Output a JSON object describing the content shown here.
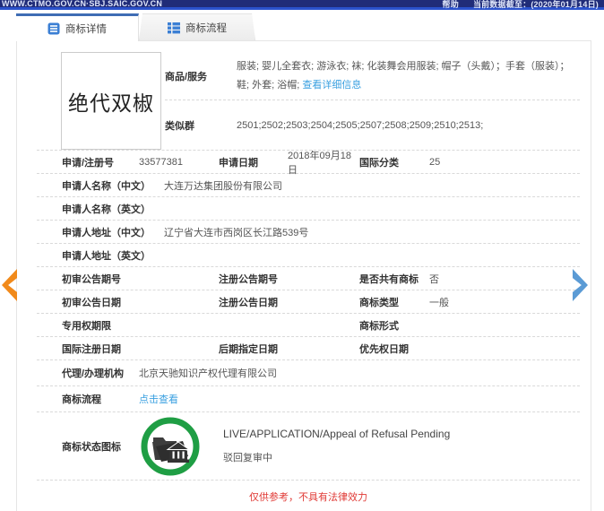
{
  "topbar": {
    "site": "WWW.CTMO.GOV.CN·SBJ.SAIC.GOV.CN",
    "help": "帮助",
    "data_cutoff": "当前数据截至：(2020年01月14日)"
  },
  "tabs": [
    {
      "label": "商标详情"
    },
    {
      "label": "商标流程"
    }
  ],
  "trademark": {
    "name": "绝代双椒",
    "goods_label": "商品/服务",
    "goods": "服装; 婴儿全套衣; 游泳衣; 袜; 化装舞会用服装; 帽子（头戴）；手套（服装）；鞋; 外套; 浴帽;",
    "goods_link": "查看详细信息",
    "similar_group_label": "类似群",
    "similar_group": "2501;2502;2503;2504;2505;2507;2508;2509;2510;2513;"
  },
  "details": {
    "reg_no_label": "申请/注册号",
    "reg_no": "33577381",
    "apply_date_label": "申请日期",
    "apply_date": "2018年09月18日",
    "intl_class_label": "国际分类",
    "intl_class": "25",
    "applicant_cn_label": "申请人名称（中文）",
    "applicant_cn": "大连万达集团股份有限公司",
    "applicant_en_label": "申请人名称（英文）",
    "applicant_en": "",
    "address_cn_label": "申请人地址（中文）",
    "address_cn": "辽宁省大连市西岗区长江路539号",
    "address_en_label": "申请人地址（英文）",
    "address_en": "",
    "prelim_no_label": "初审公告期号",
    "prelim_no": "",
    "reg_ann_no_label": "注册公告期号",
    "reg_ann_no": "",
    "shared_label": "是否共有商标",
    "shared": "否",
    "prelim_date_label": "初审公告日期",
    "prelim_date": "",
    "reg_ann_date_label": "注册公告日期",
    "reg_ann_date": "",
    "type_label": "商标类型",
    "type": "一般",
    "right_period_label": "专用权期限",
    "right_period": "",
    "form_label": "商标形式",
    "form": "",
    "intl_reg_date_label": "国际注册日期",
    "intl_reg_date": "",
    "later_desig_date_label": "后期指定日期",
    "later_desig_date": "",
    "priority_date_label": "优先权日期",
    "priority_date": "",
    "agent_label": "代理/办理机构",
    "agent": "北京天驰知识产权代理有限公司",
    "flow_label": "商标流程",
    "flow_link": "点击查看"
  },
  "status": {
    "label": "商标状态图标",
    "icon": "green-circle-folder-bank-icon",
    "status_en": "LIVE/APPLICATION/Appeal of Refusal Pending",
    "status_cn": "驳回复审中"
  },
  "footer_note": "仅供参考，不具有法律效力",
  "colors": {
    "topbar_bg": "#202c78",
    "topbar_strip": "#2b52cc",
    "accent_blue": "#3b7fd4",
    "link_blue": "#3aa0e0",
    "arrow_orange": "#f18a1b",
    "arrow_blue": "#5b9bd5",
    "status_green": "#1f9e44",
    "note_red": "#e03a36"
  }
}
